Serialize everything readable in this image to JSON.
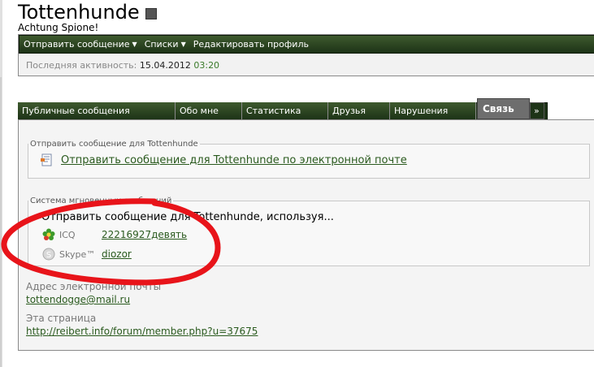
{
  "header": {
    "title": "Tottenhunde",
    "subtitle": "Achtung Spione!"
  },
  "menu": {
    "items": [
      {
        "label": "Отправить сообщение",
        "has_dropdown": true
      },
      {
        "label": "Списки",
        "has_dropdown": true
      },
      {
        "label": "Редактировать профиль",
        "has_dropdown": false
      }
    ]
  },
  "activity": {
    "label": "Последняя активность:",
    "date": "15.04.2012",
    "time": "03:20"
  },
  "tabs": [
    {
      "label": "Публичные сообщения"
    },
    {
      "label": "Обо мне"
    },
    {
      "label": "Статистика"
    },
    {
      "label": "Друзья"
    },
    {
      "label": "Нарушения"
    },
    {
      "label": "Связь",
      "active": true
    },
    {
      "label": "»"
    }
  ],
  "contact": {
    "send_message_legend": "Отправить сообщение для Tottenhunde",
    "email_link": "Отправить сообщение для Tottenhunde по электронной почте",
    "im_legend": "Система мгновенных сообщений",
    "im_title": "Отправить сообщение для Tottenhunde, используя...",
    "icq_label": "ICQ",
    "icq_value": "22216927девять",
    "skype_label": "Skype™",
    "skype_value": "diozor"
  },
  "info": {
    "email_label": "Адрес электронной почты",
    "email_value": "tottendogge@mail.ru",
    "page_label": "Эта страница",
    "page_url": "http://reibert.info/forum/member.php?u=37675"
  },
  "colors": {
    "nav_green": "#1d3317",
    "link_green": "#2a5a1e",
    "annotation_red": "#e8141a"
  }
}
